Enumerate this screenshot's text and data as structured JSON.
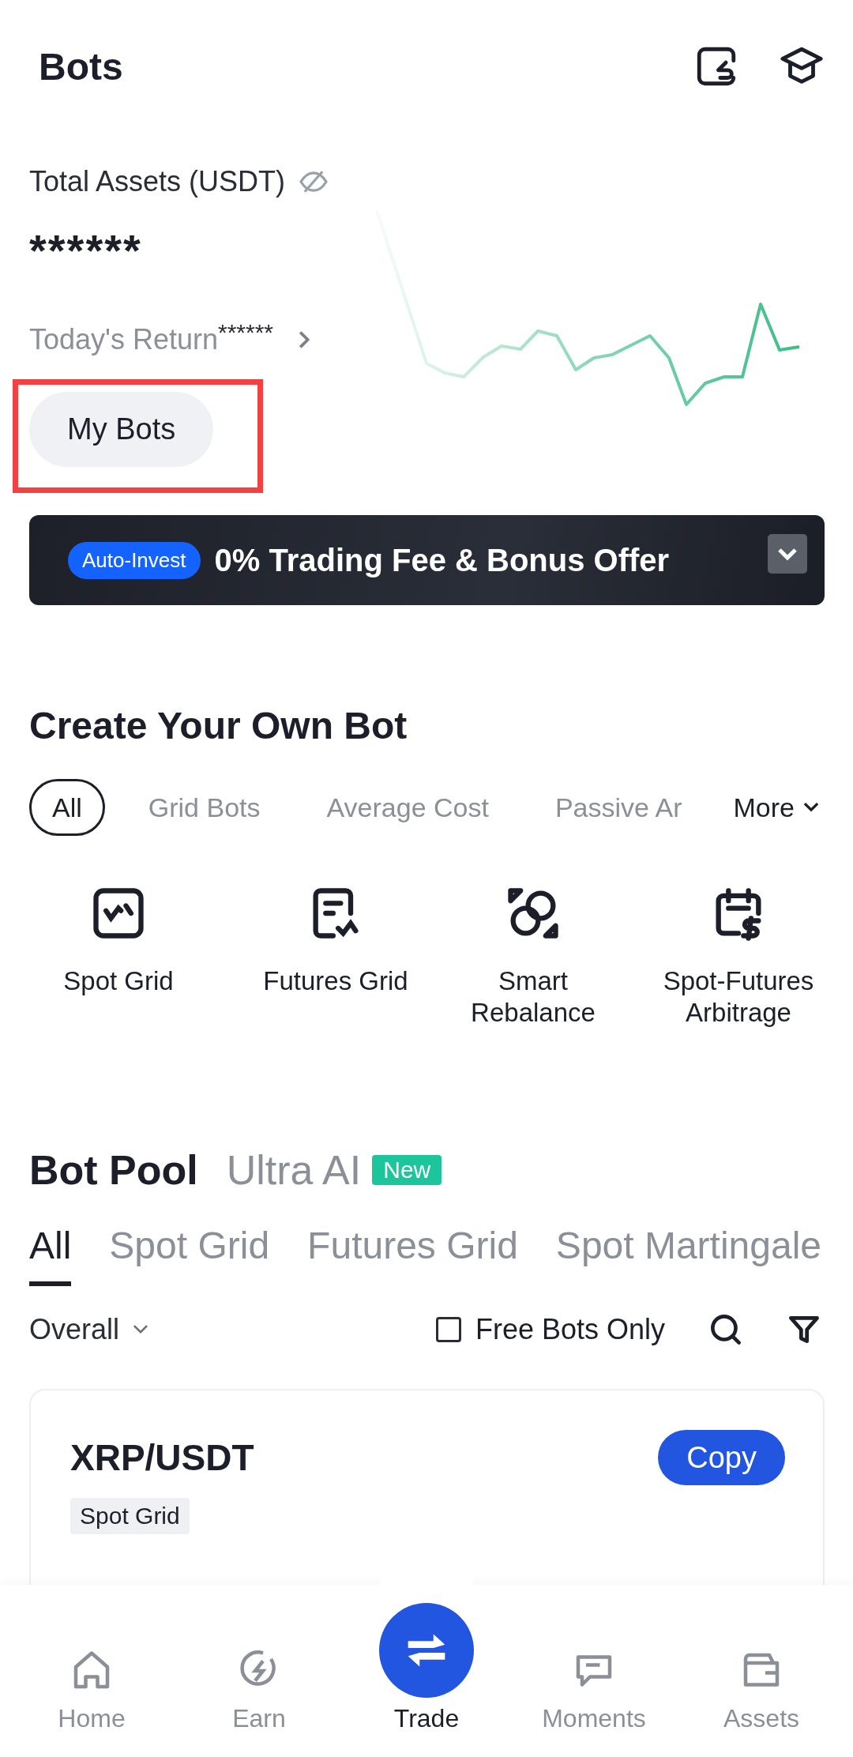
{
  "header": {
    "title": "Bots"
  },
  "assets": {
    "label": "Total Assets (USDT)",
    "value": "******",
    "return_label": "Today's Return",
    "return_value": "******"
  },
  "my_bots": {
    "label": "My Bots",
    "highlighted": true
  },
  "banner": {
    "badge": "Auto-Invest",
    "text": "0% Trading Fee & Bonus Offer"
  },
  "create": {
    "title": "Create Your Own Bot",
    "more": "More",
    "filters": [
      {
        "label": "All",
        "selected": true
      },
      {
        "label": "Grid Bots",
        "selected": false
      },
      {
        "label": "Average Cost",
        "selected": false
      },
      {
        "label": "Passive Ar",
        "selected": false
      }
    ],
    "bots": [
      {
        "label": "Spot Grid",
        "kind": "spot-grid"
      },
      {
        "label": "Futures Grid",
        "kind": "futures-grid"
      },
      {
        "label": "Smart Rebalance",
        "kind": "rebalance"
      },
      {
        "label": "Spot-Futures Arbitrage",
        "kind": "arbitrage"
      }
    ]
  },
  "pool": {
    "title": "Bot Pool",
    "ai": "Ultra AI",
    "ai_badge": "New",
    "sort": "Overall",
    "free_only": {
      "label": "Free Bots Only",
      "checked": false
    },
    "tabs": [
      {
        "label": "All",
        "selected": true
      },
      {
        "label": "Spot Grid",
        "selected": false
      },
      {
        "label": "Futures Grid",
        "selected": false
      },
      {
        "label": "Spot Martingale",
        "selected": false
      }
    ]
  },
  "cards": [
    {
      "pair": "XRP/USDT",
      "tag": "Spot Grid",
      "action": "Copy"
    }
  ],
  "nav": [
    {
      "label": "Home",
      "kind": "home",
      "selected": false
    },
    {
      "label": "Earn",
      "kind": "earn",
      "selected": false
    },
    {
      "label": "Trade",
      "kind": "trade",
      "selected": true
    },
    {
      "label": "Moments",
      "kind": "moments",
      "selected": false
    },
    {
      "label": "Assets",
      "kind": "assets",
      "selected": false
    }
  ]
}
